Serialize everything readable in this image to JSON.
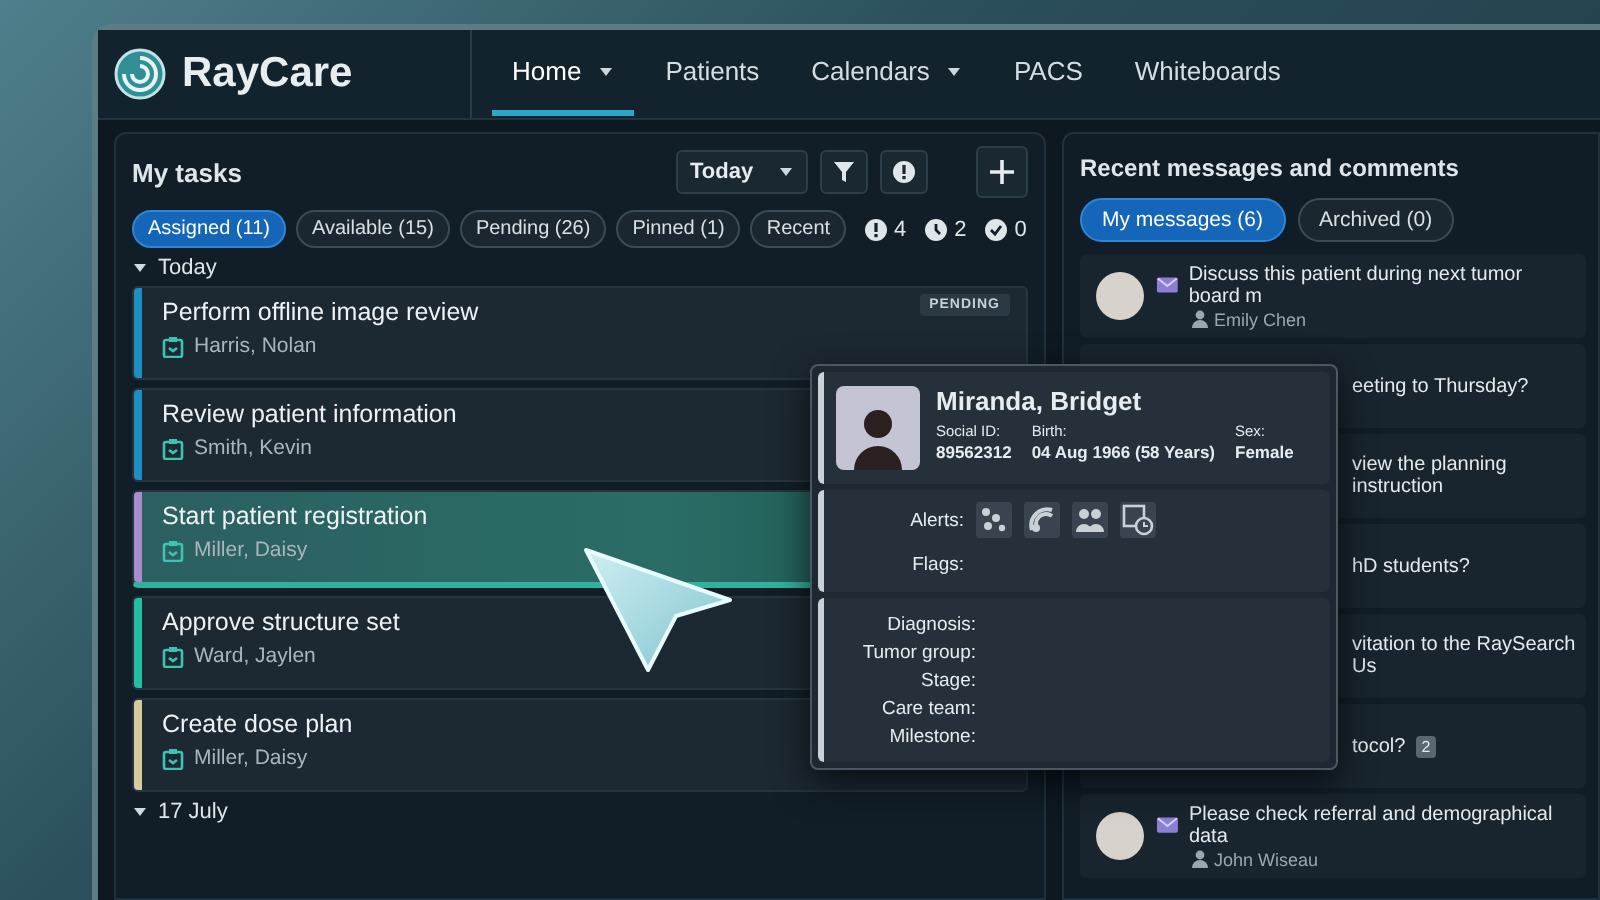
{
  "app": {
    "name": "RayCare"
  },
  "nav": [
    {
      "label": "Home",
      "selected": true,
      "dropdown": true
    },
    {
      "label": "Patients",
      "selected": false,
      "dropdown": false
    },
    {
      "label": "Calendars",
      "selected": false,
      "dropdown": true
    },
    {
      "label": "PACS",
      "selected": false,
      "dropdown": false
    },
    {
      "label": "Whiteboards",
      "selected": false,
      "dropdown": false
    }
  ],
  "tasks": {
    "title": "My tasks",
    "period": "Today",
    "filters": [
      {
        "label": "Assigned (11)",
        "selected": true
      },
      {
        "label": "Available (15)",
        "selected": false
      },
      {
        "label": "Pending (26)",
        "selected": false
      },
      {
        "label": "Pinned (1)",
        "selected": false
      },
      {
        "label": "Recent",
        "selected": false
      }
    ],
    "counts": [
      {
        "kind": "alert",
        "value": "4"
      },
      {
        "kind": "clock",
        "value": "2"
      },
      {
        "kind": "done",
        "value": "0"
      }
    ],
    "groups": [
      {
        "label": "Today",
        "expanded": true,
        "items": [
          {
            "title": "Perform offline image review",
            "patient": "Harris, Nolan",
            "color": "#1e8fc0",
            "selected": false,
            "badge": "PENDING"
          },
          {
            "title": "Review patient information",
            "patient": "Smith, Kevin",
            "color": "#1e8fc0",
            "selected": false
          },
          {
            "title": "Start patient registration",
            "patient": "Miller, Daisy",
            "color": "#a98bd0",
            "selected": true
          },
          {
            "title": "Approve structure set",
            "patient": "Ward, Jaylen",
            "color": "#20c0a0",
            "selected": false
          },
          {
            "title": "Create dose plan",
            "patient": "Miller, Daisy",
            "color": "#d8caa0",
            "selected": false
          }
        ]
      },
      {
        "label": "17 July",
        "expanded": true
      }
    ]
  },
  "messages": {
    "title": "Recent messages and comments",
    "tabs": [
      {
        "label": "My messages (6)",
        "selected": true
      },
      {
        "label": "Archived (0)",
        "selected": false
      }
    ],
    "items": [
      {
        "text": "Discuss this patient during next tumor board m",
        "author": "Emily Chen",
        "unread": true
      },
      {
        "text": "eeting to Thursday?"
      },
      {
        "text": "view the planning instruction"
      },
      {
        "text": "hD students?"
      },
      {
        "text": "vitation to the RaySearch Us"
      },
      {
        "text": "tocol?",
        "count": "2"
      },
      {
        "text": "Please check referral and demographical data",
        "author": "John Wiseau",
        "unread": true
      }
    ]
  },
  "popup": {
    "name": "Miranda, Bridget",
    "fields": [
      {
        "label": "Social ID:",
        "value": "89562312"
      },
      {
        "label": "Birth:",
        "value": "04 Aug 1966 (58 Years)"
      },
      {
        "label": "Sex:",
        "value": "Female"
      }
    ],
    "alerts_label": "Alerts:",
    "alerts": [
      {
        "kind": "dots"
      },
      {
        "kind": "radiation"
      },
      {
        "kind": "team"
      },
      {
        "kind": "schedule"
      }
    ],
    "flags_label": "Flags:",
    "details": [
      "Diagnosis:",
      "Tumor group:",
      "Stage:",
      "Care team:",
      "Milestone:"
    ]
  }
}
